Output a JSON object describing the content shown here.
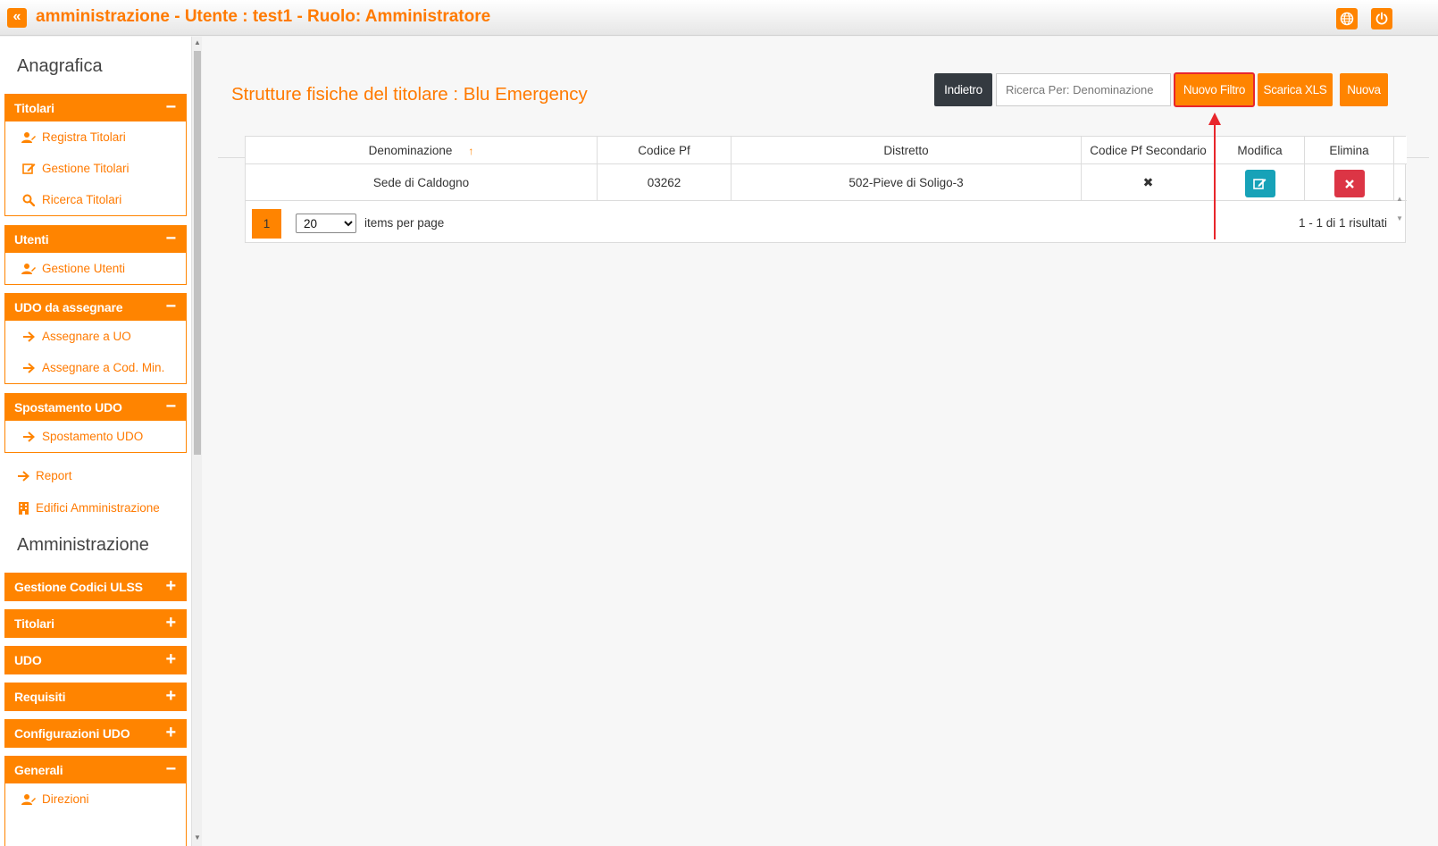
{
  "topbar": {
    "title": "amministrazione - Utente : test1 - Ruolo: Amministratore",
    "collapse_glyph": "«",
    "icons": [
      "angle-double-left-icon",
      "globe-icon",
      "power-icon"
    ]
  },
  "sidebar": {
    "heading_anagrafica": "Anagrafica",
    "heading_amministrazione": "Amministrazione",
    "panels": {
      "titolari": {
        "title": "Titolari",
        "toggle": "−",
        "items": [
          "Registra Titolari",
          "Gestione Titolari",
          "Ricerca Titolari"
        ]
      },
      "utenti": {
        "title": "Utenti",
        "toggle": "−",
        "items": [
          "Gestione Utenti"
        ]
      },
      "udo_assegnare": {
        "title": "UDO da assegnare",
        "toggle": "−",
        "items": [
          "Assegnare a UO",
          "Assegnare a Cod. Min."
        ]
      },
      "spostamento": {
        "title": "Spostamento UDO",
        "toggle": "−",
        "items": [
          "Spostamento UDO"
        ]
      },
      "gestione_codici": {
        "title": "Gestione Codici ULSS",
        "toggle": "+"
      },
      "titolari2": {
        "title": "Titolari",
        "toggle": "+"
      },
      "udo": {
        "title": "UDO",
        "toggle": "+"
      },
      "requisiti": {
        "title": "Requisiti",
        "toggle": "+"
      },
      "config_udo": {
        "title": "Configurazioni UDO",
        "toggle": "+"
      },
      "generali": {
        "title": "Generali",
        "toggle": "−",
        "items": [
          "Direzioni"
        ]
      }
    },
    "loose_items": [
      "Report",
      "Edifici Amministrazione"
    ]
  },
  "main": {
    "page_title": "Strutture fisiche del titolare : Blu Emergency",
    "buttons": {
      "back": "Indietro",
      "new_filter": "Nuovo Filtro",
      "download_xls": "Scarica XLS",
      "new": "Nuova"
    },
    "search": {
      "placeholder": "Ricerca Per: Denominazione",
      "value": ""
    },
    "table": {
      "columns": [
        "Denominazione",
        "Codice Pf",
        "Distretto",
        "Codice Pf Secondario",
        "Modifica",
        "Elimina"
      ],
      "sort_glyph": "↑",
      "rows": [
        {
          "denominazione": "Sede di Caldogno",
          "codice_pf": "03262",
          "distretto": "502-Pieve di Soligo-3",
          "codice_pf_secondario": "✖"
        }
      ]
    },
    "pager": {
      "current_page": "1",
      "page_size": "20",
      "page_size_options": [
        "20"
      ],
      "items_per_page_label": "items per page",
      "results": "1 - 1 di 1 risultati"
    }
  },
  "colors": {
    "accent": "#ff8400",
    "accent_text": "#ff7a00",
    "dark_button": "#343a40",
    "edit_button": "#17a2b8",
    "delete_button": "#dc3545",
    "annotation": "#e8262c"
  }
}
